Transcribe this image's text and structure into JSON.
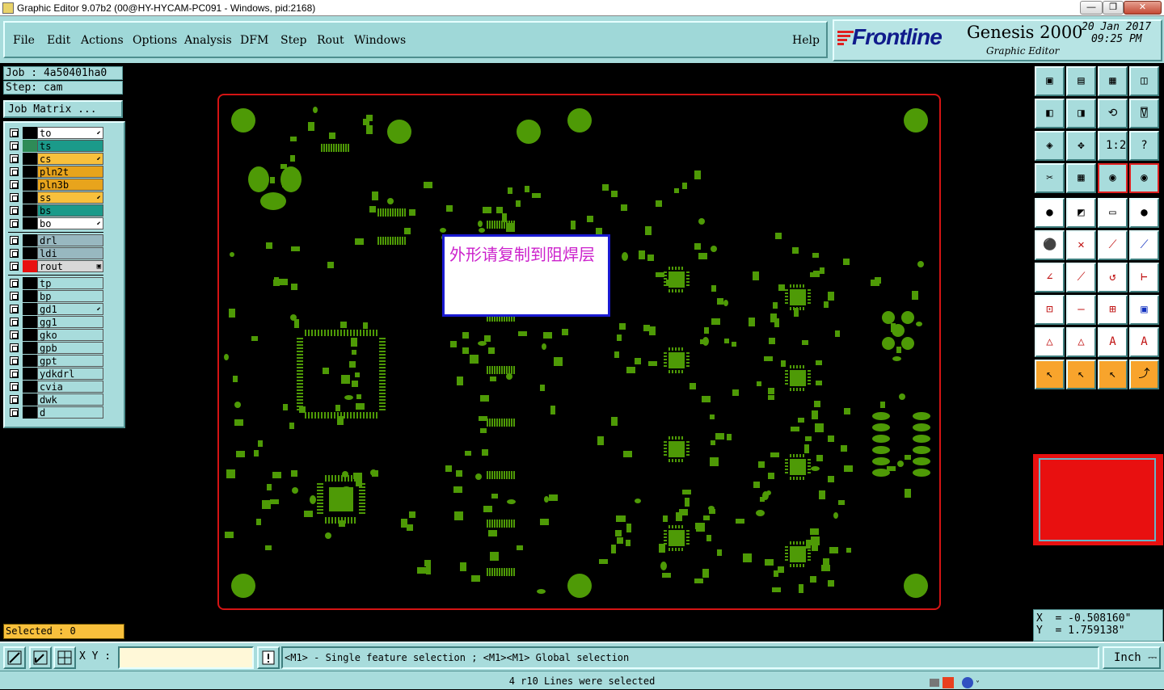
{
  "window": {
    "title": "Graphic Editor 9.07b2 (00@HY-HYCAM-PC091 - Windows, pid:2168)",
    "minimize": "—",
    "maximize": "❐",
    "close": "✕"
  },
  "menu": {
    "items": [
      "File",
      "Edit",
      "Actions",
      "Options",
      "Analysis",
      "DFM",
      "Step",
      "Rout",
      "Windows"
    ],
    "help": "Help"
  },
  "brand": {
    "logo": "Frontline",
    "product": "Genesis 2000",
    "subtitle": "Graphic Editor",
    "date": "20 Jan 2017",
    "time": "09:25 PM"
  },
  "job": {
    "job_label": "Job : 4a50401ha0",
    "step_label": "Step: cam",
    "matrix_button": "Job Matrix ..."
  },
  "layers": [
    {
      "name": "to",
      "bg": "#ffffff",
      "swatch": "#000000",
      "flag": "⬋"
    },
    {
      "name": "ts",
      "bg": "#1b9a8a",
      "swatch": "#2e8b57",
      "flag": ""
    },
    {
      "name": "cs",
      "bg": "#f8c03c",
      "swatch": "#000000",
      "flag": "⬋"
    },
    {
      "name": "pln2t",
      "bg": "#e8a41c",
      "swatch": "#000000",
      "flag": ""
    },
    {
      "name": "pln3b",
      "bg": "#e8a41c",
      "swatch": "#000000",
      "flag": ""
    },
    {
      "name": "ss",
      "bg": "#f8c03c",
      "swatch": "#000000",
      "flag": "⬋"
    },
    {
      "name": "bs",
      "bg": "#1b9a8a",
      "swatch": "#000000",
      "flag": ""
    },
    {
      "name": "bo",
      "bg": "#ffffff",
      "swatch": "#000000",
      "flag": "⬋"
    },
    {
      "name": "drl",
      "bg": "#98b8c0",
      "swatch": "#000000",
      "flag": ""
    },
    {
      "name": "ldi",
      "bg": "#98b8c0",
      "swatch": "#000000",
      "flag": ""
    },
    {
      "name": "rout",
      "bg": "#d8d8d8",
      "swatch": "#e81010",
      "flag": "▣"
    },
    {
      "name": "tp",
      "bg": "#a8dcdc",
      "swatch": "#000000",
      "flag": ""
    },
    {
      "name": "bp",
      "bg": "#a8dcdc",
      "swatch": "#000000",
      "flag": ""
    },
    {
      "name": "gd1",
      "bg": "#a8dcdc",
      "swatch": "#000000",
      "flag": "⬋"
    },
    {
      "name": "gg1",
      "bg": "#a8dcdc",
      "swatch": "#000000",
      "flag": ""
    },
    {
      "name": "gko",
      "bg": "#a8dcdc",
      "swatch": "#000000",
      "flag": ""
    },
    {
      "name": "gpb",
      "bg": "#a8dcdc",
      "swatch": "#000000",
      "flag": ""
    },
    {
      "name": "gpt",
      "bg": "#a8dcdc",
      "swatch": "#000000",
      "flag": ""
    },
    {
      "name": "ydkdrl",
      "bg": "#a8dcdc",
      "swatch": "#000000",
      "flag": ""
    },
    {
      "name": "cvia",
      "bg": "#a8dcdc",
      "swatch": "#000000",
      "flag": ""
    },
    {
      "name": "dwk",
      "bg": "#a8dcdc",
      "swatch": "#000000",
      "flag": ""
    },
    {
      "name": "d",
      "bg": "#a8dcdc",
      "swatch": "#000000",
      "flag": ""
    }
  ],
  "selected": "Selected : 0",
  "note": "外形请复制到阻焊层",
  "coords": {
    "x": "X  = -0.508160\"",
    "y": "Y  = 1.759138\""
  },
  "input": {
    "xy_label": "X Y :",
    "xy_value": "",
    "message": "<M1> - Single feature selection ; <M1><M1> Global selection",
    "unit": "Inch"
  },
  "status": "4 r10 Lines were selected",
  "colors": {
    "panel": "#a8dcdc",
    "pad": "#4e9a06",
    "outline": "#d41414",
    "note_text": "#cc22cc",
    "note_border": "#1a1ad2",
    "overview": "#e81010"
  },
  "toolbar_icons": [
    "zoom-home-icon",
    "zoom-fit-icon",
    "zoom-window-icon",
    "zoom-split-icon",
    "pan-left-icon",
    "pan-right-icon",
    "undo-zoom-icon",
    "redraw-icon",
    "zoom-in-icon",
    "zoom-out-icon",
    "scale-1to2-icon",
    "query-icon",
    "feature-filter-icon",
    "grid-icon",
    "layer-display-icon",
    "layer-display-alt-icon",
    "snap-center-icon",
    "snap-edge-icon",
    "measure-ruler-icon",
    "snap-pad-icon",
    "connect-icon",
    "snap-intersect-icon",
    "snap-point-red-icon",
    "snap-point-blue-icon",
    "angle-icon",
    "line-draw-icon",
    "arc-icon",
    "mirror-icon",
    "move-point-icon",
    "cut-line-icon",
    "dimension-icon",
    "component-icon",
    "text-small-icon",
    "text-mid-icon",
    "text-large-icon",
    "text-baseline-icon",
    "select-pointer-icon",
    "select-box-icon",
    "select-round-icon",
    "select-path-icon"
  ],
  "bottom_icons": [
    "resize-icon",
    "move-icon",
    "grid-snap-icon",
    "alert-icon"
  ]
}
